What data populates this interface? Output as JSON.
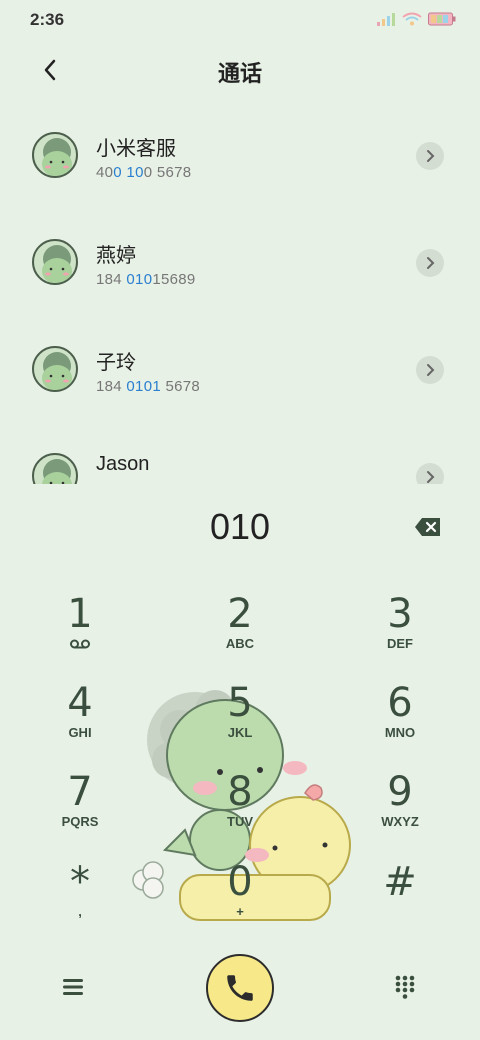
{
  "status_bar": {
    "time": "2:36"
  },
  "header": {
    "title": "通话"
  },
  "calls": [
    {
      "name": "小米客服",
      "number_parts": [
        "40",
        "0 10",
        "0 5678"
      ]
    },
    {
      "name": "燕婷",
      "number_parts": [
        "184 ",
        "010",
        "15689"
      ]
    },
    {
      "name": "子玲",
      "number_parts": [
        "184 ",
        "0101",
        " 5678"
      ]
    },
    {
      "name": "Jason",
      "number_parts": [
        "",
        "",
        ""
      ]
    }
  ],
  "dialer": {
    "number": "010"
  },
  "keypad": {
    "keys": [
      {
        "digit": "1",
        "letters": ""
      },
      {
        "digit": "2",
        "letters": "ABC"
      },
      {
        "digit": "3",
        "letters": "DEF"
      },
      {
        "digit": "4",
        "letters": "GHI"
      },
      {
        "digit": "5",
        "letters": "JKL"
      },
      {
        "digit": "6",
        "letters": "MNO"
      },
      {
        "digit": "7",
        "letters": "PQRS"
      },
      {
        "digit": "8",
        "letters": "TUV"
      },
      {
        "digit": "9",
        "letters": "WXYZ"
      },
      {
        "digit": "*",
        "letters": ","
      },
      {
        "digit": "0",
        "letters": "+"
      },
      {
        "digit": "#",
        "letters": ""
      }
    ]
  },
  "colors": {
    "background": "#e8f1e6",
    "accent_blue": "#2a7fcf",
    "call_button": "#f7e98a",
    "key_text": "#3b4f3f"
  },
  "icons": {
    "back": "back-arrow-icon",
    "delete": "backspace-icon",
    "menu": "menu-icon",
    "call": "phone-icon",
    "keypad": "dialpad-icon",
    "voicemail": "voicemail-icon"
  }
}
